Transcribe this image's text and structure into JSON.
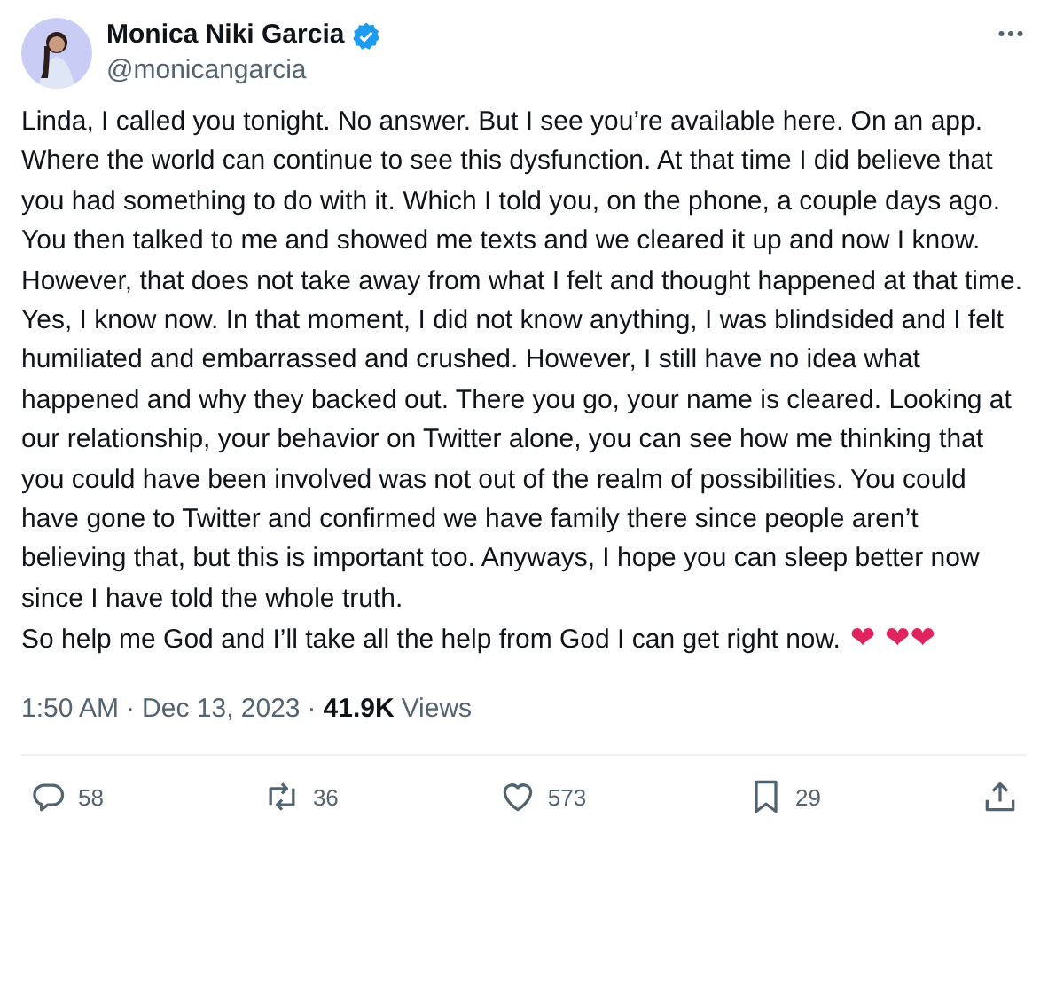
{
  "author": {
    "name": "Monica Niki Garcia",
    "verified": true,
    "handle": "@monicangarcia"
  },
  "body": [
    "Linda, I called you tonight. No answer. But I see you’re available here. On an app. Where the world can continue to see this dysfunction. At that time I did believe that you had something to do with it. Which I told you, on the phone, a couple days ago. You then talked to me and showed me texts and we cleared it up and now I know. However, that does not take away from what I felt and thought happened at that time. Yes, I know now. In that moment, I did not know anything, I was blindsided and I felt humiliated and embarrassed and crushed. However, I still have no idea what happened and why they backed out. There you go, your name is cleared. Looking at our relationship, your behavior on Twitter alone, you can see how me thinking that you could have been involved was not out of the realm of possibilities. You could have gone to Twitter and confirmed we have family there since people aren’t believing that, but this is important too. Anyways, I hope you can sleep better now since I have told the whole truth.",
    "So help me God and I’ll take all the help from God I can get right now."
  ],
  "hearts": "❤ ❤❤",
  "meta": {
    "time": "1:50 AM",
    "separator": "·",
    "date": "Dec 13, 2023",
    "views_count": "41.9K",
    "views_label": "Views"
  },
  "actions": [
    {
      "kind": "reply",
      "count": "58"
    },
    {
      "kind": "repost",
      "count": "36"
    },
    {
      "kind": "like",
      "count": "573"
    },
    {
      "kind": "bookmark",
      "count": "29"
    },
    {
      "kind": "share"
    }
  ]
}
